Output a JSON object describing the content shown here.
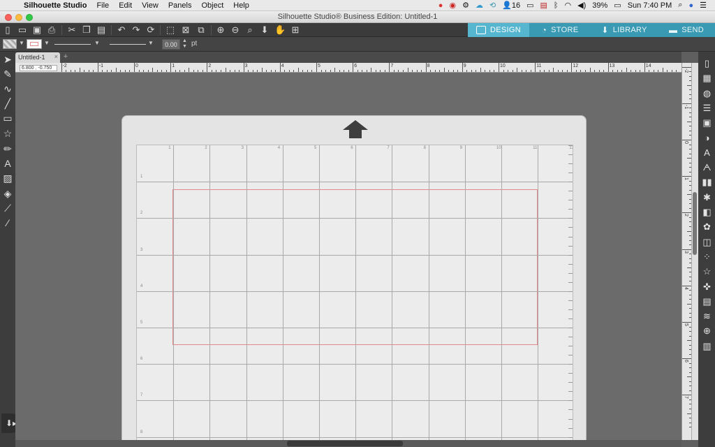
{
  "menubar": {
    "app_name": "Silhouette Studio",
    "items": [
      "File",
      "Edit",
      "View",
      "Panels",
      "Object",
      "Help"
    ],
    "status": {
      "badge_count": "16",
      "battery": "39%",
      "clock": "Sun 7:40 PM"
    }
  },
  "window": {
    "title": "Silhouette Studio® Business Edition: Untitled-1"
  },
  "toolbar": {
    "icons": [
      "new-document-icon",
      "open-icon",
      "save-icon",
      "print-icon",
      "cut-icon",
      "copy-icon",
      "paste-icon",
      "undo-icon",
      "redo-icon",
      "redraw-icon",
      "select-all-icon",
      "deselect-icon",
      "group-icon",
      "zoom-in-icon",
      "zoom-out-icon",
      "zoom-fit-icon",
      "pan-icon",
      "fit-to-page-icon"
    ]
  },
  "nav_tabs": [
    {
      "label": "DESIGN",
      "active": true,
      "icon": "grid-icon"
    },
    {
      "label": "STORE",
      "active": false,
      "icon": "store-icon"
    },
    {
      "label": "LIBRARY",
      "active": false,
      "icon": "library-icon"
    },
    {
      "label": "SEND",
      "active": false,
      "icon": "send-icon"
    }
  ],
  "options_bar": {
    "line_width_value": "0.00",
    "unit": "pt",
    "line_color": "#e4898b"
  },
  "document_tab": {
    "label": "Untitled-1",
    "close": "×",
    "new_tab": "+"
  },
  "coordinates": {
    "x": "6.800",
    "y": "-0.750"
  },
  "ruler": {
    "h_labels": [
      "-2",
      "-1",
      "0",
      "1",
      "2",
      "3",
      "4",
      "5",
      "6",
      "7",
      "8",
      "9",
      "10",
      "11",
      "12",
      "13",
      "14"
    ],
    "v_labels": [
      "-2",
      "-1",
      "0",
      "1",
      "2",
      "3",
      "4",
      "5",
      "6",
      "7"
    ]
  },
  "mat": {
    "col_numbers": [
      "1",
      "2",
      "3",
      "4",
      "5",
      "6",
      "7",
      "8",
      "9",
      "10",
      "11",
      "12"
    ],
    "row_numbers": [
      "1",
      "2",
      "3",
      "4",
      "5",
      "6",
      "7",
      "8"
    ]
  },
  "left_tools": [
    "select-arrow-icon",
    "point-edit-icon",
    "smooth-icon",
    "line-icon",
    "rectangle-icon",
    "star-icon",
    "pencil-icon",
    "text-icon",
    "image-icon",
    "eraser-icon",
    "knife-icon",
    "eyedropper-icon"
  ],
  "right_panel": [
    "page-setup-icon",
    "pixscan-icon",
    "fill-icon",
    "line-style-icon",
    "transform-icon",
    "contrast-icon",
    "text-style-icon",
    "font-icon",
    "align-icon",
    "replicate-icon",
    "modify-icon",
    "offset-icon",
    "trace-icon",
    "rhinestone-icon",
    "sketch-icon",
    "emboss-icon",
    "library-panel-icon",
    "pattern-icon",
    "nesting-icon",
    "shop-icon"
  ],
  "colors": {
    "accent": "#3a9ab3",
    "accent_active": "#57b6cf",
    "cut_border": "#e4898b"
  }
}
